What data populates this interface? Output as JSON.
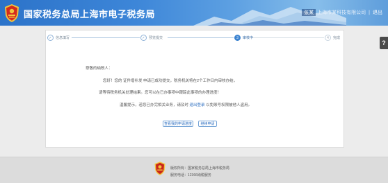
{
  "header": {
    "title": "国家税务总局上海市电子税务局",
    "user_name": "张某",
    "user_org": "上海市某科技有限公司",
    "logout_label": "退出",
    "colors": {
      "header_start": "#2c73c9",
      "header_end": "#86bdea",
      "emblem_red": "#d42a1e",
      "emblem_gold": "#f2c43d"
    }
  },
  "help_tab": {
    "label": "?"
  },
  "steps": [
    {
      "number": "✓",
      "label": "信息填写",
      "state": "done"
    },
    {
      "number": "✓",
      "label": "预览提交",
      "state": "done"
    },
    {
      "number": "3",
      "label": "审核中",
      "state": "active"
    },
    {
      "number": "4",
      "label": "完成",
      "state": "pending"
    }
  ],
  "message": {
    "salutation": "尊敬的纳税人：",
    "line1": "您好！您的 证件增补发 申请已成功提交，税务机关将在2个工作日内审核办结，",
    "line2": "请等待税务机关处理结果。您可以在已办事项中跟踪此事项的办理进度！",
    "line3_prefix": "温馨提示，若您已办完相关业务，请及时",
    "line3_link": "退出登录",
    "line3_suffix": "以免账号权限被他人盗用。"
  },
  "buttons": {
    "view_progress": "查看我的申请进度",
    "continue": "继续申请"
  },
  "footer": {
    "copyright": "版权所有：国家税务总局上海市税务局",
    "hotline": "服务电话：12366纳税服务"
  }
}
